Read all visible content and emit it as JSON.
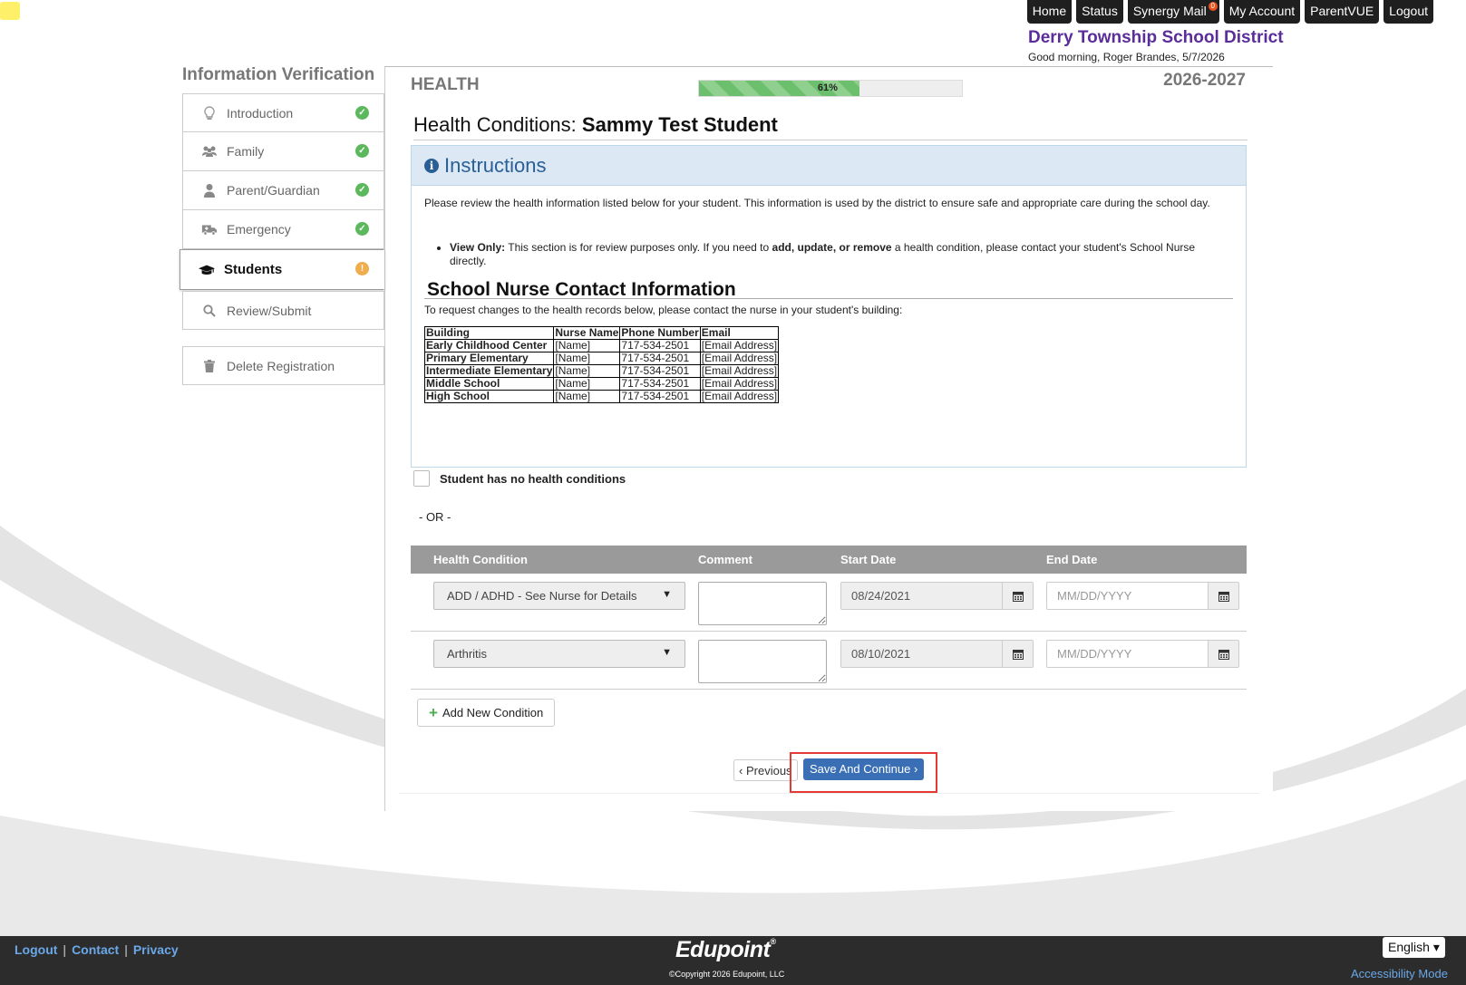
{
  "top_nav": {
    "items": [
      "Home",
      "Status",
      "Synergy Mail",
      "My Account",
      "ParentVUE",
      "Logout"
    ],
    "mail_badge": "0"
  },
  "district": {
    "name": "Derry Township School District",
    "greeting": "Good morning, Roger Brandes, 5/7/2026"
  },
  "sidebar": {
    "title": "Information Verification",
    "items": [
      {
        "label": "Introduction",
        "icon": "lightbulb-icon",
        "status": "complete"
      },
      {
        "label": "Family",
        "icon": "users-icon",
        "status": "complete"
      },
      {
        "label": "Parent/Guardian",
        "icon": "user-icon",
        "status": "complete"
      },
      {
        "label": "Emergency",
        "icon": "ambulance-icon",
        "status": "complete"
      },
      {
        "label": "Students",
        "icon": "graduation-cap-icon",
        "status": "warning"
      },
      {
        "label": "Review/Submit",
        "icon": "search-icon",
        "status": ""
      }
    ],
    "delete_label": "Delete Registration"
  },
  "main": {
    "section_title": "HEALTH",
    "progress": {
      "percent": 61,
      "label": "61%"
    },
    "school_year": "2026-2027",
    "heading_prefix": "Health Conditions:",
    "student_name": "Sammy Test Student",
    "instructions": {
      "title": "Instructions",
      "para": "Please review the health information listed below for your student. This information is used by the district to ensure safe and appropriate care during the school day.",
      "bullet_bold": "View Only:",
      "bullet_text1": " This section is for review purposes only. If you need to ",
      "bullet_bold2": "add, update, or remove",
      "bullet_text2": " a health condition, please contact your student's School Nurse directly.",
      "nurse_title": "School Nurse Contact Information",
      "nurse_intro": "To request changes to the health records below, please contact the nurse in your student's building:",
      "nurse_headers": [
        "Building",
        "Nurse Name",
        "Phone Number",
        "Email"
      ],
      "nurse_rows": [
        [
          "Early Childhood Center",
          "[Name]",
          "717-534-2501",
          "[Email Address]"
        ],
        [
          "Primary Elementary",
          "[Name]",
          "717-534-2501",
          "[Email Address]"
        ],
        [
          "Intermediate Elementary",
          "[Name]",
          "717-534-2501",
          "[Email Address]"
        ],
        [
          "Middle School",
          "[Name]",
          "717-534-2501",
          "[Email Address]"
        ],
        [
          "High School",
          "[Name]",
          "717-534-2501",
          "[Email Address]"
        ]
      ]
    },
    "no_conditions_label": "Student has no health conditions",
    "or_label": "- OR -",
    "conditions": {
      "headers": [
        "Health Condition",
        "Comment",
        "Start Date",
        "End Date"
      ],
      "rows": [
        {
          "condition": "ADD / ADHD - See Nurse for Details",
          "comment": "",
          "start": "08/24/2021",
          "end_placeholder": "MM/DD/YYYY"
        },
        {
          "condition": "Arthritis",
          "comment": "",
          "start": "08/10/2021",
          "end_placeholder": "MM/DD/YYYY"
        }
      ]
    },
    "add_label": "Add New Condition",
    "prev_label": "Previous",
    "save_label": "Save And Continue"
  },
  "footer": {
    "links": [
      "Logout",
      "Contact",
      "Privacy"
    ],
    "brand": "Edupoint",
    "copyright": "©Copyright 2026 Edupoint, LLC",
    "language": "English",
    "accessibility": "Accessibility Mode"
  }
}
